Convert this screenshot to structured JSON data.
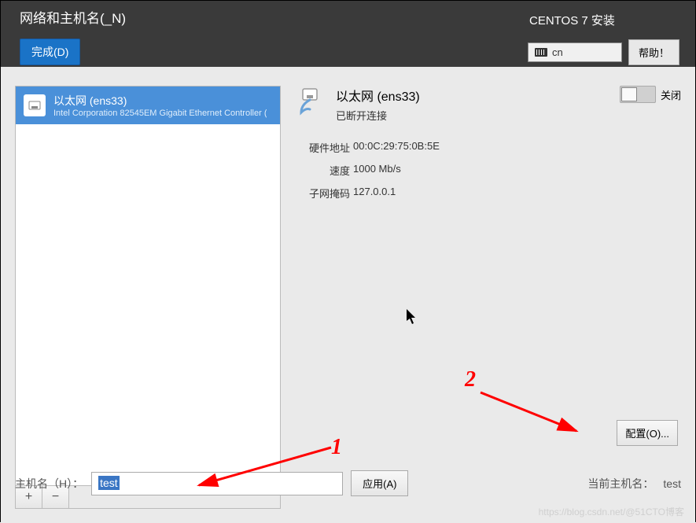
{
  "header": {
    "title": "网络和主机名(_N)",
    "done_label": "完成(D)",
    "install_label": "CENTOS 7 安装",
    "keyboard_label": "cn",
    "help_label": "帮助！"
  },
  "device_list": {
    "items": [
      {
        "name": "以太网 (ens33)",
        "desc": "Intel Corporation 82545EM Gigabit Ethernet Controller ("
      }
    ],
    "add_label": "+",
    "remove_label": "−"
  },
  "detail": {
    "conn_title": "以太网 (ens33)",
    "conn_status": "已断开连接",
    "toggle_label": "关闭",
    "fields": {
      "hw_label": "硬件地址",
      "hw_value": "00:0C:29:75:0B:5E",
      "speed_label": "速度",
      "speed_value": "1000 Mb/s",
      "mask_label": "子网掩码",
      "mask_value": "127.0.0.1"
    },
    "configure_label": "配置(O)..."
  },
  "hostname": {
    "label": "主机名（H）：",
    "value": "test",
    "apply_label": "应用(A)",
    "current_label": "当前主机名：",
    "current_value": "test"
  },
  "annotations": {
    "num1": "1",
    "num2": "2",
    "arrow_color": "#ff0000"
  },
  "watermark": "https://blog.csdn.net/@51CTO博客"
}
